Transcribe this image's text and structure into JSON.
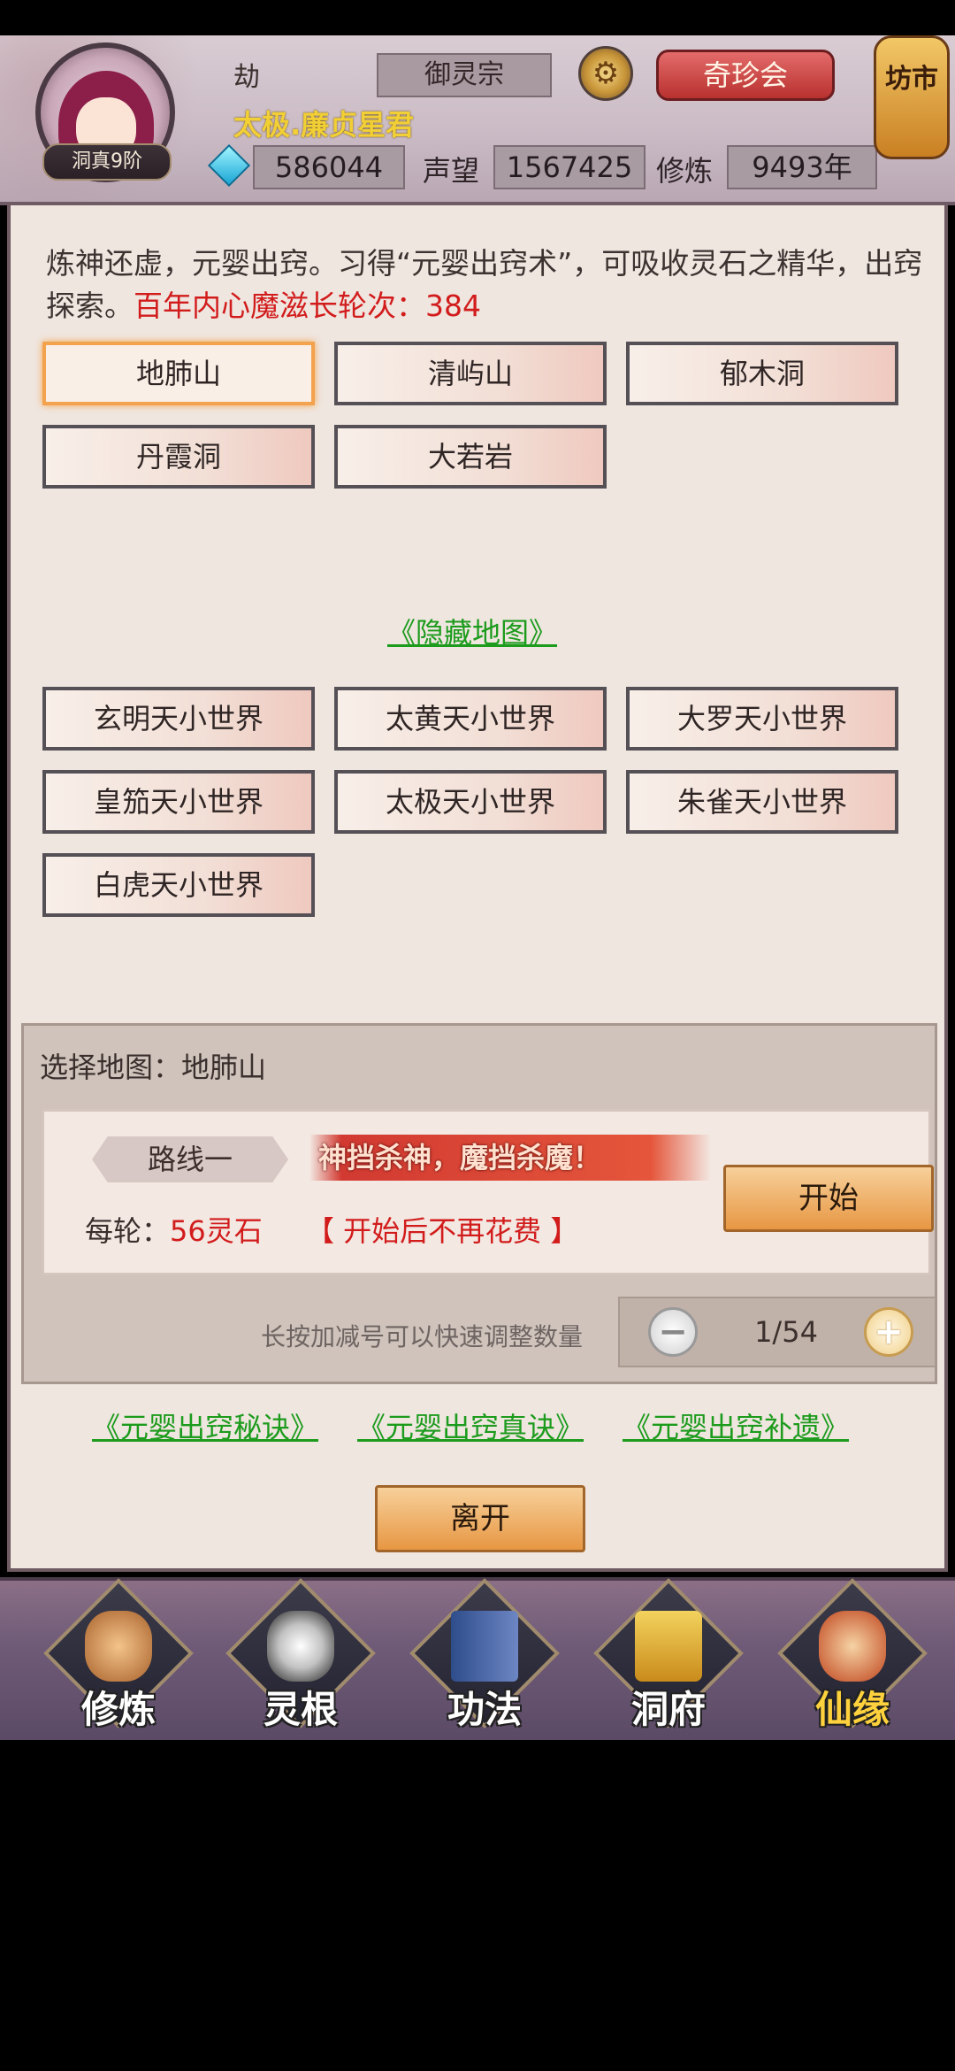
{
  "header": {
    "rank_badge": "洞真9阶",
    "tribulation": "劫",
    "sect": "御灵宗",
    "treasure_button": "奇珍会",
    "title": "太极.廉贞星君",
    "gems": "586044",
    "reputation_label": "声望",
    "reputation_value": "1567425",
    "cultivation_label": "修炼",
    "cultivation_value": "9493年",
    "market": "坊市",
    "settings_icon": "gear-icon",
    "gem_icon": "gem-icon"
  },
  "description": {
    "text": "炼神还虚，元婴出窍。习得“元婴出窍术”，可吸收灵石之精华，出窍探索。",
    "highlight": "百年内心魔滋长轮次：384"
  },
  "maps": [
    {
      "label": "地肺山",
      "selected": true
    },
    {
      "label": "清屿山"
    },
    {
      "label": "郁木洞"
    },
    {
      "label": "丹霞洞"
    },
    {
      "label": "大若岩"
    }
  ],
  "hidden_maps_link": "《隐藏地图》",
  "hidden_maps": [
    {
      "label": "玄明天小世界"
    },
    {
      "label": "太黄天小世界"
    },
    {
      "label": "大罗天小世界"
    },
    {
      "label": "皇笳天小世界"
    },
    {
      "label": "太极天小世界"
    },
    {
      "label": "朱雀天小世界"
    },
    {
      "label": "白虎天小世界"
    }
  ],
  "selection": {
    "label": "选择地图：地肺山",
    "route": "路线一",
    "slogan": "神挡杀神，魔挡杀魔！",
    "per_round_label": "每轮：",
    "per_round_value": "56灵石",
    "no_fee": "【 开始后不再花费 】",
    "start_button": "开始",
    "hint": "长按加减号可以快速调整数量",
    "count": "1/54"
  },
  "links": [
    "《元婴出窍秘诀》",
    "《元婴出窍真诀》",
    "《元婴出窍补遗》"
  ],
  "leave_button": "离开",
  "nav": [
    {
      "label": "修炼",
      "icon": "meditation-icon"
    },
    {
      "label": "灵根",
      "icon": "spirit-root-icon"
    },
    {
      "label": "功法",
      "icon": "scripture-book-icon"
    },
    {
      "label": "洞府",
      "icon": "cave-dwelling-icon"
    },
    {
      "label": "仙缘",
      "icon": "gourd-icon",
      "active": true
    }
  ],
  "colors": {
    "accent_red": "#d21c1c",
    "link_green": "#1c9b1c",
    "button_orange": "#e79743"
  }
}
